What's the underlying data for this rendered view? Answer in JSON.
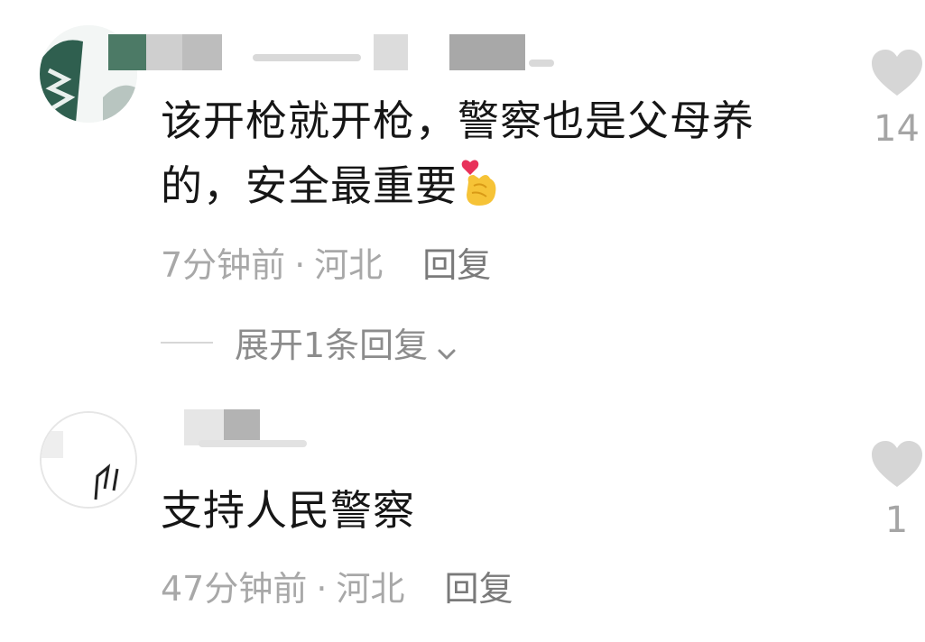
{
  "comments": [
    {
      "text_line1": "该开枪就开枪，警察也是父母养",
      "text_line2": "的，安全最重要",
      "emoji_icon": "finger-heart-icon",
      "time": "7分钟前",
      "separator": "·",
      "location": "河北",
      "reply_label": "回复",
      "expand_label": "展开1条回复",
      "like_count": "14"
    },
    {
      "text": "支持人民警察",
      "time": "47分钟前",
      "separator": "·",
      "location": "河北",
      "reply_label": "回复",
      "like_count": "1"
    }
  ],
  "colors": {
    "like_heart": "#d6d6d6",
    "meta_text": "#a8a8a8",
    "reply_text": "#7a7a7a"
  }
}
